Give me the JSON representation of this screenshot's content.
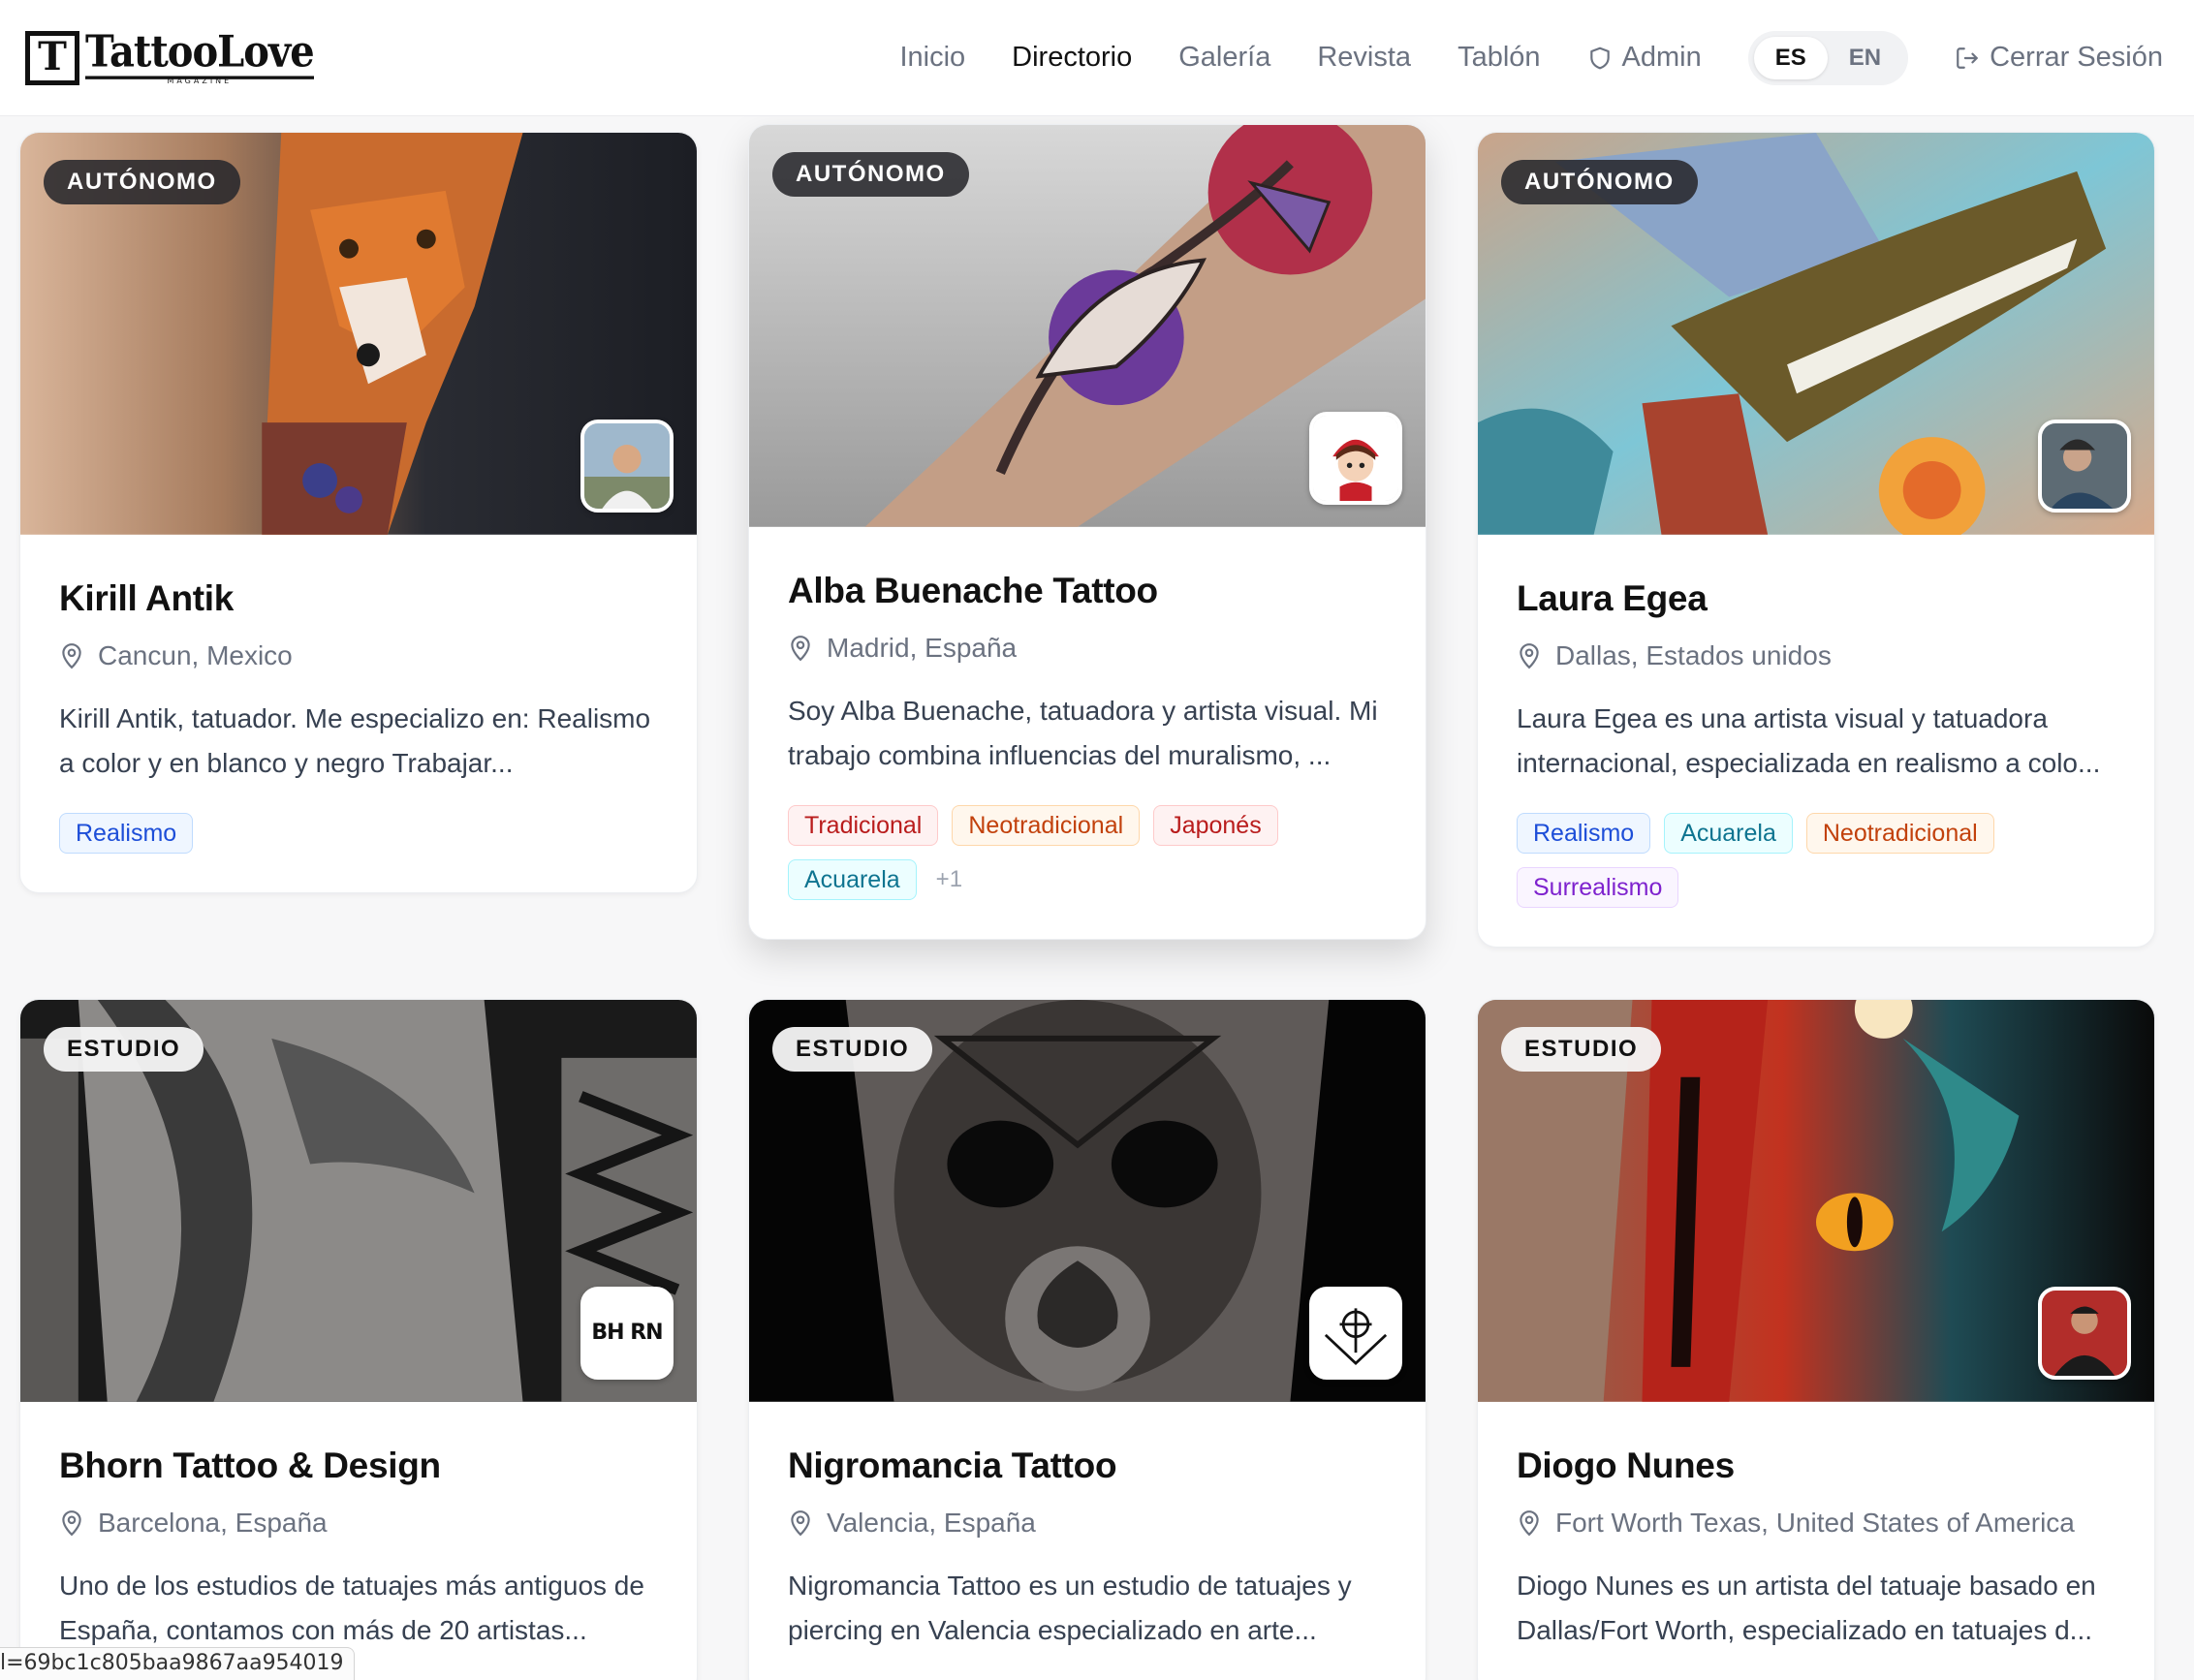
{
  "header": {
    "logo_text": "TattooLove",
    "logo_sub": "magazine",
    "nav": [
      "Inicio",
      "Directorio",
      "Galería",
      "Revista",
      "Tablón",
      "Admin"
    ],
    "lang": [
      "ES",
      "EN"
    ],
    "logout": "Cerrar Sesión"
  },
  "cards": [
    {
      "badge": "AUTÓNOMO",
      "name": "Kirill Antik",
      "location": "Cancun, Mexico",
      "description": "Kirill Antik, tatuador. Me especializo en: Realismo a color y en blanco y negro Trabajar...",
      "tags": [
        "Realismo"
      ]
    },
    {
      "badge": "AUTÓNOMO",
      "name": "Alba Buenache Tattoo",
      "location": "Madrid, España",
      "description": "Soy Alba Buenache, tatuadora y artista visual. Mi trabajo combina influencias del muralismo, ...",
      "tags": [
        "Tradicional",
        "Neotradicional",
        "Japonés",
        "Acuarela"
      ],
      "more": "+1"
    },
    {
      "badge": "AUTÓNOMO",
      "name": "Laura Egea",
      "location": "Dallas, Estados unidos",
      "description": "Laura Egea es una artista visual y tatuadora internacional, especializada en realismo a colo...",
      "tags": [
        "Realismo",
        "Acuarela",
        "Neotradicional",
        "Surrealismo"
      ]
    },
    {
      "badge": "ESTUDIO",
      "name": "Bhorn Tattoo & Design",
      "location": "Barcelona, España",
      "description": "Uno de los estudios de tatuajes más antiguos de España, contamos con más de 20 artistas...",
      "avatar_text": "BH RN"
    },
    {
      "badge": "ESTUDIO",
      "name": "Nigromancia Tattoo",
      "location": "Valencia, España",
      "description": "Nigromancia Tattoo es un estudio de tatuajes y piercing en Valencia especializado en arte..."
    },
    {
      "badge": "ESTUDIO",
      "name": "Diogo Nunes",
      "location": "Fort Worth Texas, United States of America",
      "description": "Diogo Nunes es un artista del tatuaje basado en Dallas/Fort Worth, especializado en tatuajes d..."
    }
  ],
  "status_url": "l=69bc1c805baa9867aa954019"
}
